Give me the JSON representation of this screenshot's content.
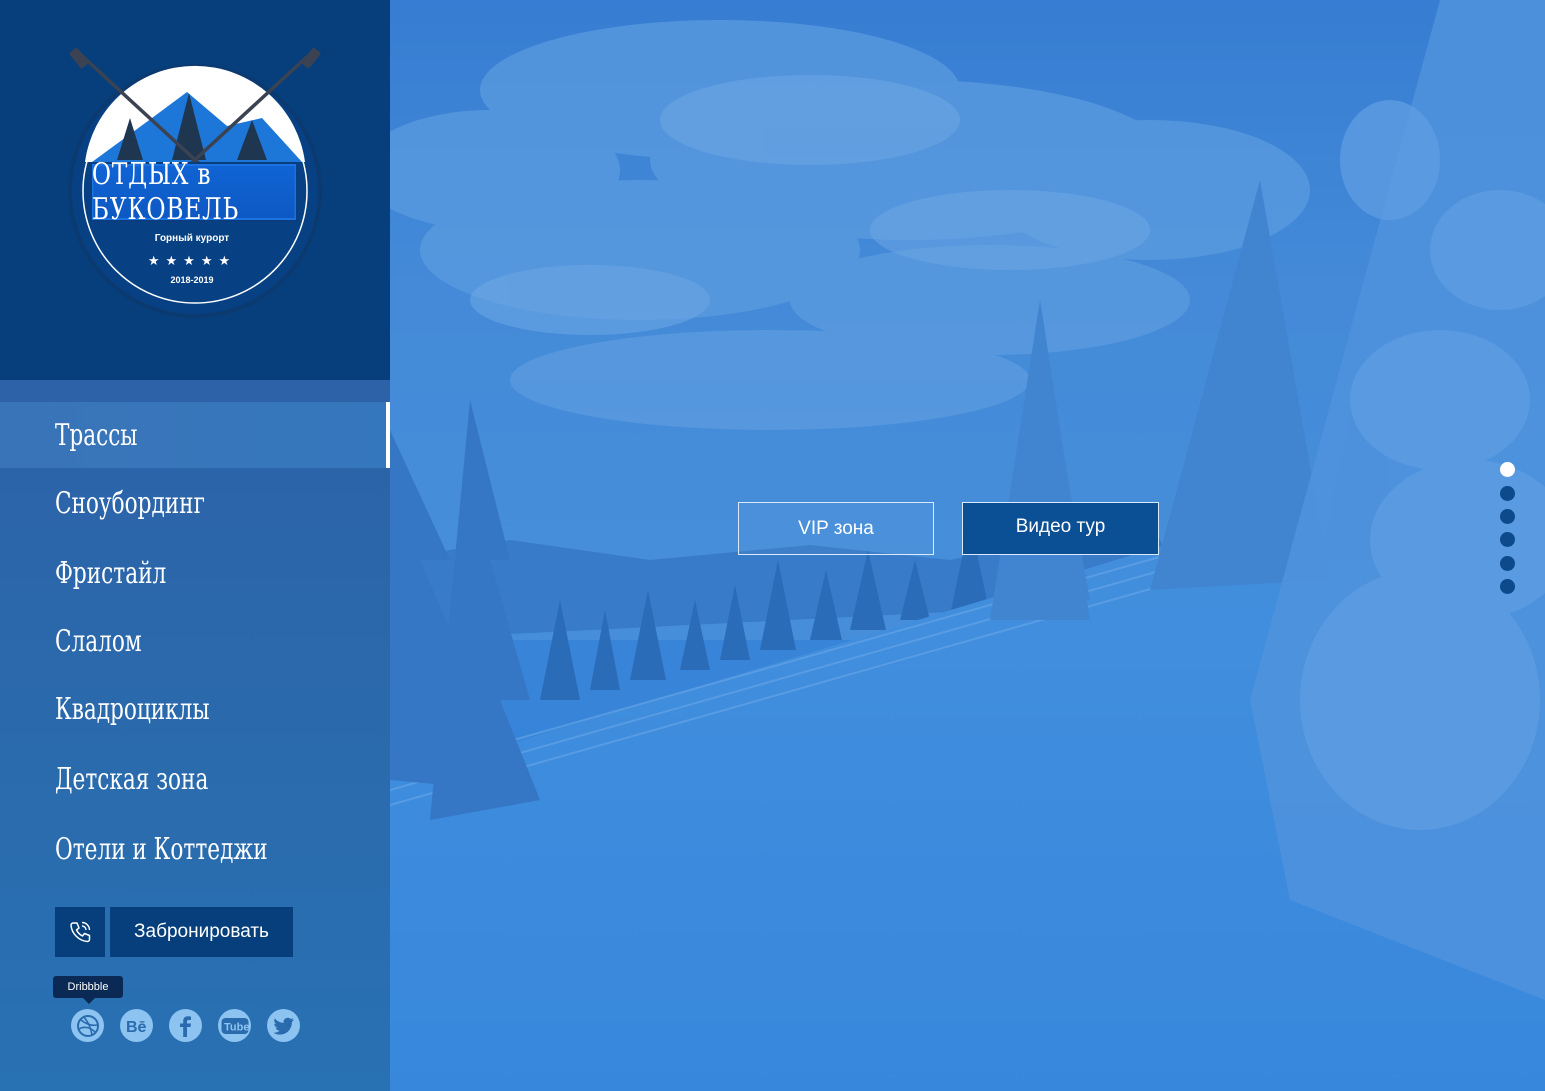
{
  "logo": {
    "title": "ОТДЫХ в БУКОВЕЛЬ",
    "subtitle": "Горный курорт",
    "stars": "★★★★★",
    "years": "2018-2019"
  },
  "nav": {
    "items": [
      {
        "label": "Трассы",
        "active": true
      },
      {
        "label": "Сноубординг",
        "active": false
      },
      {
        "label": "Фристайл",
        "active": false
      },
      {
        "label": "Слалом",
        "active": false
      },
      {
        "label": "Квадроциклы",
        "active": false
      },
      {
        "label": "Детская зона",
        "active": false
      },
      {
        "label": "Отели и Коттеджи",
        "active": false
      }
    ]
  },
  "booking": {
    "phone_icon": "phone-icon",
    "button_label": "Забронировать"
  },
  "social": {
    "tooltip": "Dribbble",
    "items": [
      {
        "name": "dribbble-icon"
      },
      {
        "name": "behance-icon"
      },
      {
        "name": "facebook-icon"
      },
      {
        "name": "youtube-icon"
      },
      {
        "name": "twitter-icon"
      }
    ]
  },
  "hero": {
    "vip_label": "VIP зона",
    "video_label": "Видео тур"
  },
  "pager": {
    "count": 6,
    "active_index": 0
  },
  "colors": {
    "sidebar_dark": "#063f7c",
    "accent": "#1064d6",
    "active_dot": "#ffffff"
  }
}
